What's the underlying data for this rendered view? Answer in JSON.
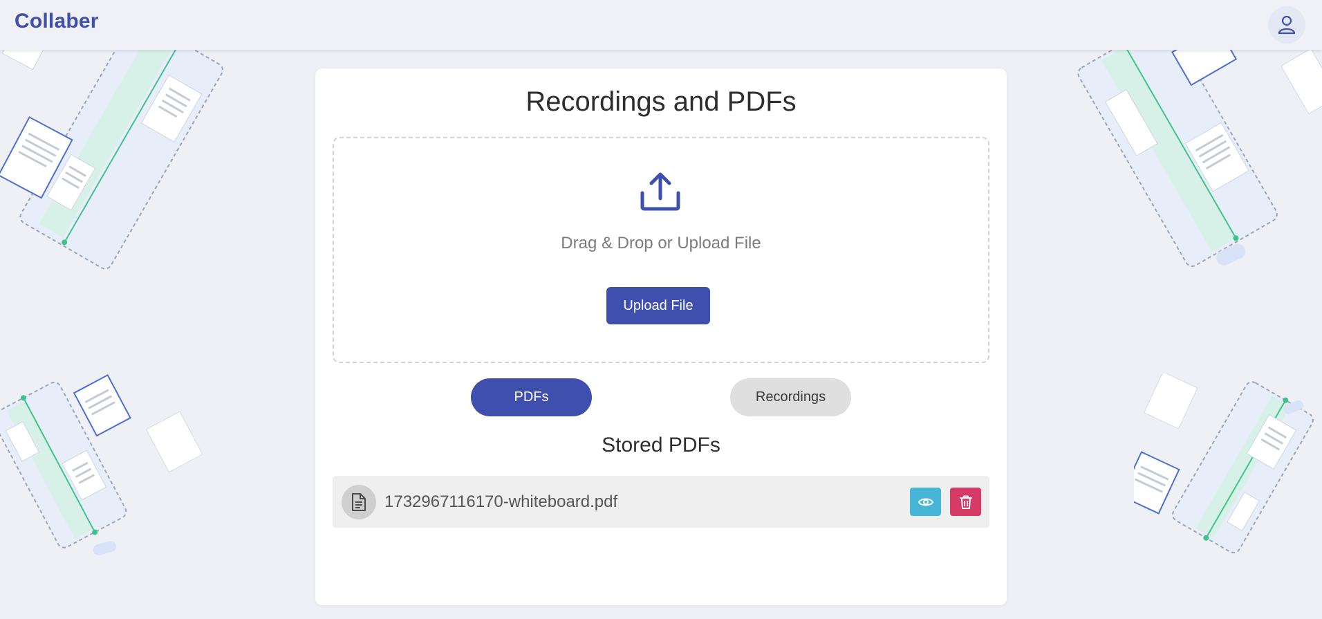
{
  "header": {
    "brand": "Collaber",
    "profile_icon": "user-icon"
  },
  "main": {
    "title": "Recordings and PDFs",
    "dropzone": {
      "icon": "upload-icon",
      "text": "Drag & Drop or Upload File",
      "button_label": "Upload File"
    },
    "tabs": [
      {
        "label": "PDFs",
        "active": true
      },
      {
        "label": "Recordings",
        "active": false
      }
    ],
    "section_title": "Stored PDFs",
    "files": [
      {
        "icon": "document-icon",
        "name": "1732967116170-whiteboard.pdf",
        "actions": [
          "eye-icon",
          "trash-icon"
        ]
      }
    ]
  },
  "colors": {
    "primary": "#3f4fae",
    "view": "#47b6d6",
    "delete": "#d63a67",
    "background": "#eef0f5",
    "accent_green": "#3ec48b"
  }
}
